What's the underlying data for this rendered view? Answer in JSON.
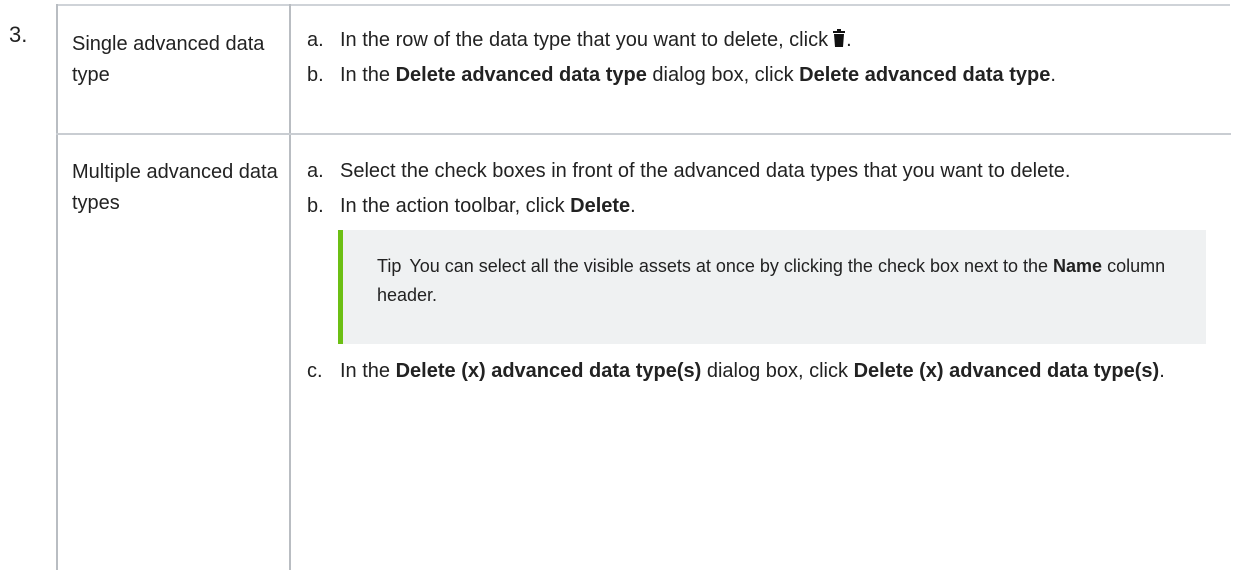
{
  "step": {
    "number": "3."
  },
  "rows": [
    {
      "label": "Single advanced data type",
      "items": [
        {
          "letter": "a.",
          "text_before": "In the row of the data type that you want to delete, click",
          "icon": "trash-icon",
          "text_after": "."
        },
        {
          "letter": "b.",
          "t1": "In the ",
          "b1": "Delete advanced data type",
          "t2": " dialog box, click ",
          "b2": "Delete advanced data type",
          "t3": "."
        }
      ]
    },
    {
      "label": "Multiple advanced data types",
      "items": [
        {
          "letter": "a.",
          "text": "Select the check boxes in front of the advanced data types that you want to delete."
        },
        {
          "letter": "b.",
          "t1": "In the action toolbar, click ",
          "b1": "Delete",
          "t2": "."
        },
        {
          "letter": "c.",
          "t1": "In the ",
          "b1": "Delete (x) advanced data type(s)",
          "t2": " dialog box, click ",
          "b2": "Delete (x) advanced data type(s)",
          "t3": "."
        }
      ],
      "tip": {
        "label": "Tip",
        "t1": "You can select all the visible assets at once by clicking the check box next to the ",
        "b1": "Name",
        "t2": " column header."
      }
    }
  ],
  "colors": {
    "tip_accent": "#6cbf14",
    "tip_background": "#eff1f2",
    "border": "#c9cdd2"
  }
}
